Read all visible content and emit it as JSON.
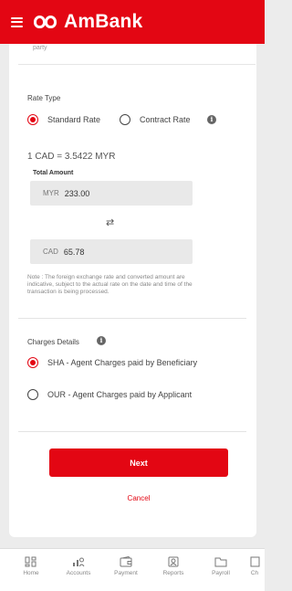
{
  "header": {
    "brand": "AmBank"
  },
  "form": {
    "cut_off_text": "party",
    "rate_type": {
      "label": "Rate Type",
      "options": [
        {
          "label": "Standard Rate",
          "selected": true
        },
        {
          "label": "Contract Rate",
          "selected": false
        }
      ]
    },
    "exchange_rate": "1 CAD = 3.5422 MYR",
    "total_amount": {
      "label": "Total Amount",
      "from_currency": "MYR",
      "from_value": "233.00",
      "to_currency": "CAD",
      "to_value": "65.78"
    },
    "note": "Note : The foreign exchange rate and converted amount are indicative, subject to the actual rate on the date and time of the transaction is being processed.",
    "charges": {
      "label": "Charges Details",
      "options": [
        {
          "label": "SHA - Agent Charges paid by Beneficiary",
          "selected": true
        },
        {
          "label": "OUR - Agent Charges paid by Applicant",
          "selected": false
        }
      ]
    },
    "next_label": "Next",
    "cancel_label": "Cancel"
  },
  "bottom_nav": {
    "items": [
      {
        "label": "Home",
        "icon": "home-icon"
      },
      {
        "label": "Accounts",
        "icon": "accounts-icon"
      },
      {
        "label": "Payment",
        "icon": "payment-icon"
      },
      {
        "label": "Reports",
        "icon": "reports-icon"
      },
      {
        "label": "Payroll",
        "icon": "payroll-icon"
      },
      {
        "label": "Ch",
        "icon": "cut-off-icon"
      }
    ]
  },
  "colors": {
    "brand_red": "#e30613",
    "field_bg": "#e9e9e9",
    "page_bg": "#ececec"
  }
}
